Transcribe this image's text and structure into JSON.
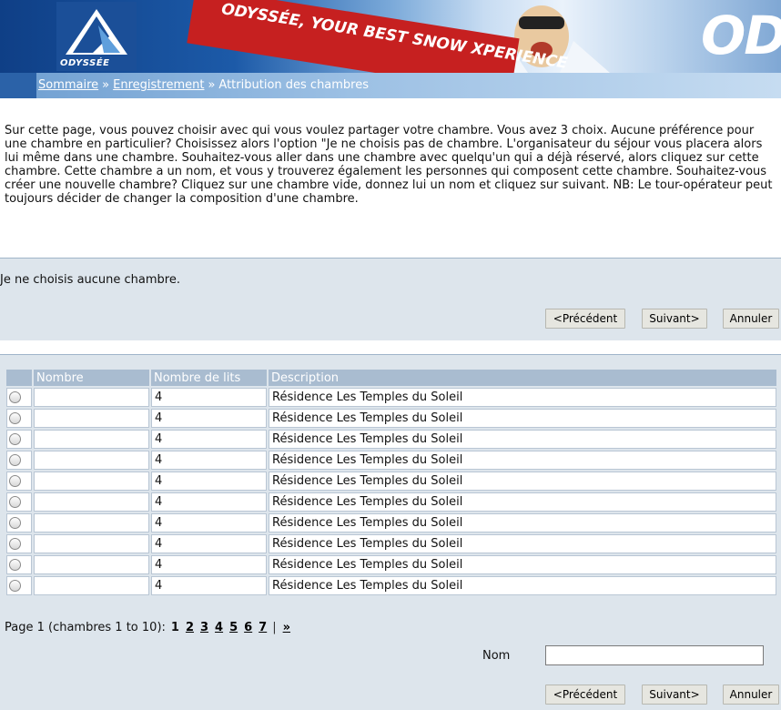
{
  "banner": {
    "logo_text": "ODYSSÉE",
    "slogan": "ODYSSÉE, YOUR BEST SNOW XPERIENCE",
    "big_text": "OD"
  },
  "breadcrumb": {
    "items": [
      "Sommaire",
      "Enregistrement",
      "Attribution des chambres"
    ],
    "separator": "»"
  },
  "intro": "Sur cette page, vous pouvez choisir avec qui vous voulez partager votre chambre. Vous avez 3 choix. Aucune préférence pour une chambre en particulier? Choisissez alors l'option \"Je ne choisis pas de chambre. L'organisateur du séjour vous placera alors lui même dans une chambre. Souhaitez-vous aller dans une chambre avec quelqu'un qui a déjà réservé, alors cliquez sur cette chambre. Cette chambre a un nom, et vous y trouverez également les personnes qui composent cette chambre. Souhaitez-vous créer une nouvelle chambre? Cliquez sur une chambre vide, donnez lui un nom et cliquez sur suivant. NB: Le tour-opérateur peut toujours décider de changer la composition d'une chambre.",
  "no_room_text": "Je ne choisis aucune chambre.",
  "buttons": {
    "previous": "<Précédent",
    "next": "Suivant>",
    "cancel": "Annuler"
  },
  "table": {
    "headers": [
      "",
      "Nombre",
      "Nombre de lits",
      "Description"
    ],
    "rows": [
      {
        "nombre": "",
        "lits": "4",
        "description": "Résidence Les Temples du Soleil"
      },
      {
        "nombre": "",
        "lits": "4",
        "description": "Résidence Les Temples du Soleil"
      },
      {
        "nombre": "",
        "lits": "4",
        "description": "Résidence Les Temples du Soleil"
      },
      {
        "nombre": "",
        "lits": "4",
        "description": "Résidence Les Temples du Soleil"
      },
      {
        "nombre": "",
        "lits": "4",
        "description": "Résidence Les Temples du Soleil"
      },
      {
        "nombre": "",
        "lits": "4",
        "description": "Résidence Les Temples du Soleil"
      },
      {
        "nombre": "",
        "lits": "4",
        "description": "Résidence Les Temples du Soleil"
      },
      {
        "nombre": "",
        "lits": "4",
        "description": "Résidence Les Temples du Soleil"
      },
      {
        "nombre": "",
        "lits": "4",
        "description": "Résidence Les Temples du Soleil"
      },
      {
        "nombre": "",
        "lits": "4",
        "description": "Résidence Les Temples du Soleil"
      }
    ]
  },
  "pager": {
    "label": "Page 1 (chambres 1 to 10):",
    "current": "1",
    "pages": [
      "2",
      "3",
      "4",
      "5",
      "6",
      "7"
    ],
    "separator": "|",
    "next": "»"
  },
  "nom": {
    "label": "Nom",
    "value": ""
  }
}
